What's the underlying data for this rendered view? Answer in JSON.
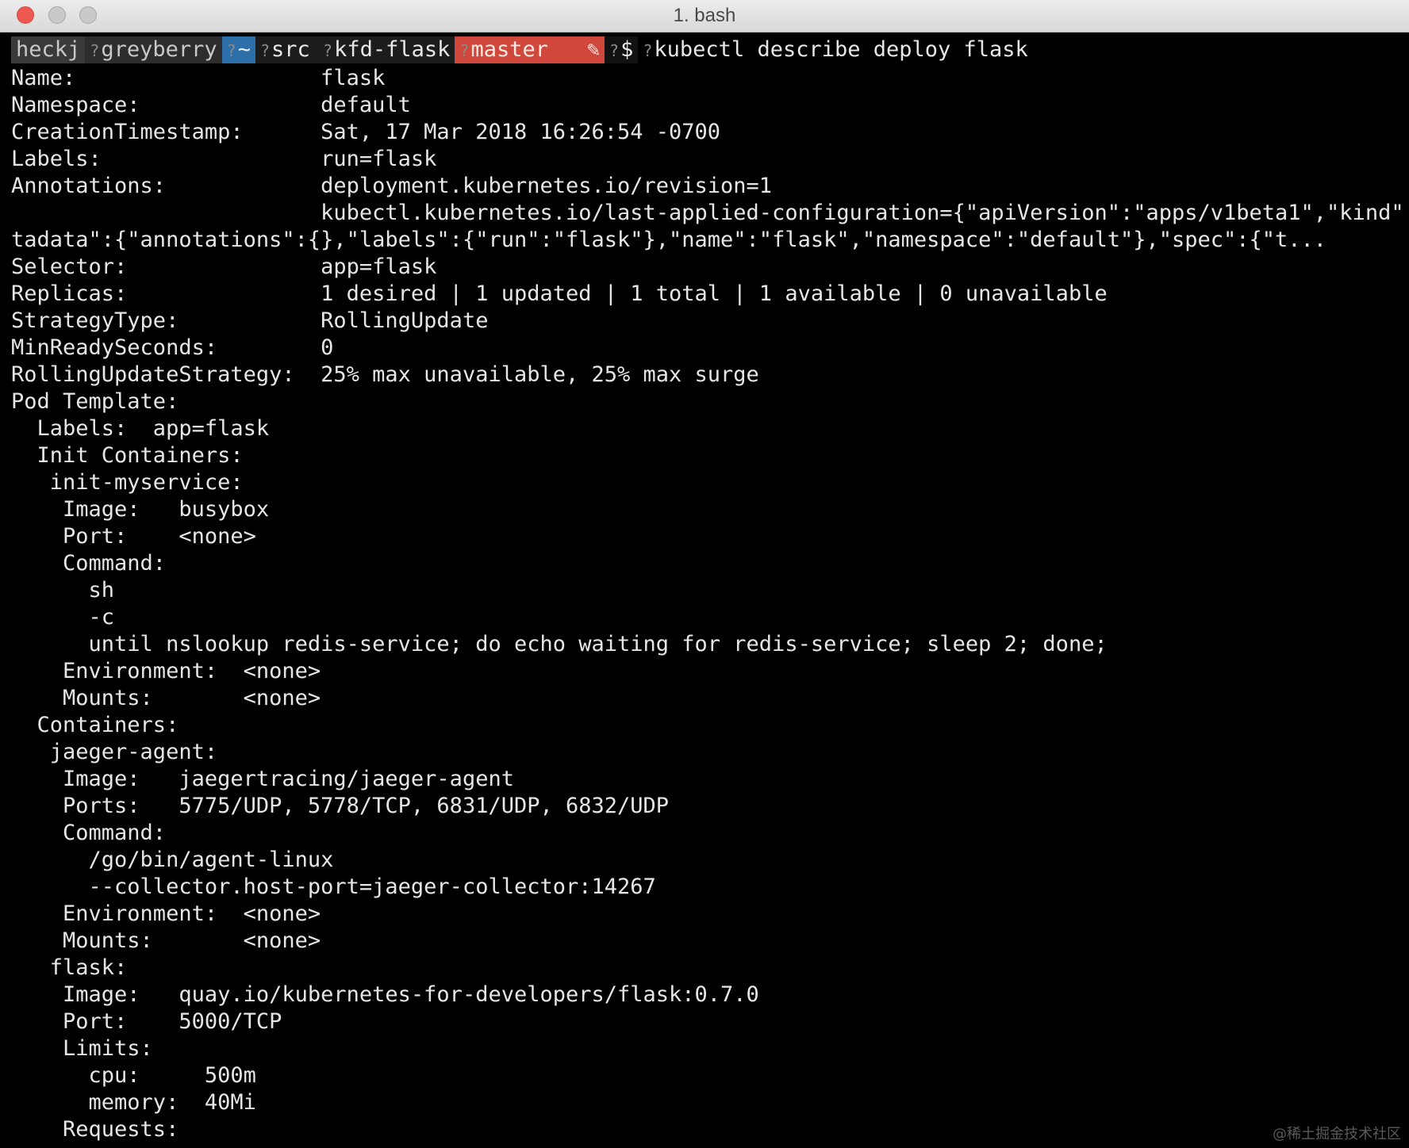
{
  "window": {
    "title": "1. bash"
  },
  "prompt": {
    "user": "heckj",
    "host": "greyberry",
    "home": "~",
    "dir1": "src",
    "dir2": "kfd-flask",
    "branch": "master",
    "dirty_mark": "✎",
    "dollar": "$",
    "command": "kubectl describe deploy flask",
    "unknown_glyph": "?"
  },
  "output": [
    "Name:                   flask",
    "Namespace:              default",
    "CreationTimestamp:      Sat, 17 Mar 2018 16:26:54 -0700",
    "Labels:                 run=flask",
    "Annotations:            deployment.kubernetes.io/revision=1",
    "                        kubectl.kubernetes.io/last-applied-configuration={\"apiVersion\":\"apps/v1beta1\",\"kind\":\"Deployment\",\"me",
    "tadata\":{\"annotations\":{},\"labels\":{\"run\":\"flask\"},\"name\":\"flask\",\"namespace\":\"default\"},\"spec\":{\"t...",
    "Selector:               app=flask",
    "Replicas:               1 desired | 1 updated | 1 total | 1 available | 0 unavailable",
    "StrategyType:           RollingUpdate",
    "MinReadySeconds:        0",
    "RollingUpdateStrategy:  25% max unavailable, 25% max surge",
    "Pod Template:",
    "  Labels:  app=flask",
    "  Init Containers:",
    "   init-myservice:",
    "    Image:   busybox",
    "    Port:    <none>",
    "    Command:",
    "      sh",
    "      -c",
    "      until nslookup redis-service; do echo waiting for redis-service; sleep 2; done;",
    "    Environment:  <none>",
    "    Mounts:       <none>",
    "  Containers:",
    "   jaeger-agent:",
    "    Image:   jaegertracing/jaeger-agent",
    "    Ports:   5775/UDP, 5778/TCP, 6831/UDP, 6832/UDP",
    "    Command:",
    "      /go/bin/agent-linux",
    "      --collector.host-port=jaeger-collector:14267",
    "    Environment:  <none>",
    "    Mounts:       <none>",
    "   flask:",
    "    Image:   quay.io/kubernetes-for-developers/flask:0.7.0",
    "    Port:    5000/TCP",
    "    Limits:",
    "      cpu:     500m",
    "      memory:  40Mi",
    "    Requests:"
  ],
  "watermark": "@稀土掘金技术社区"
}
